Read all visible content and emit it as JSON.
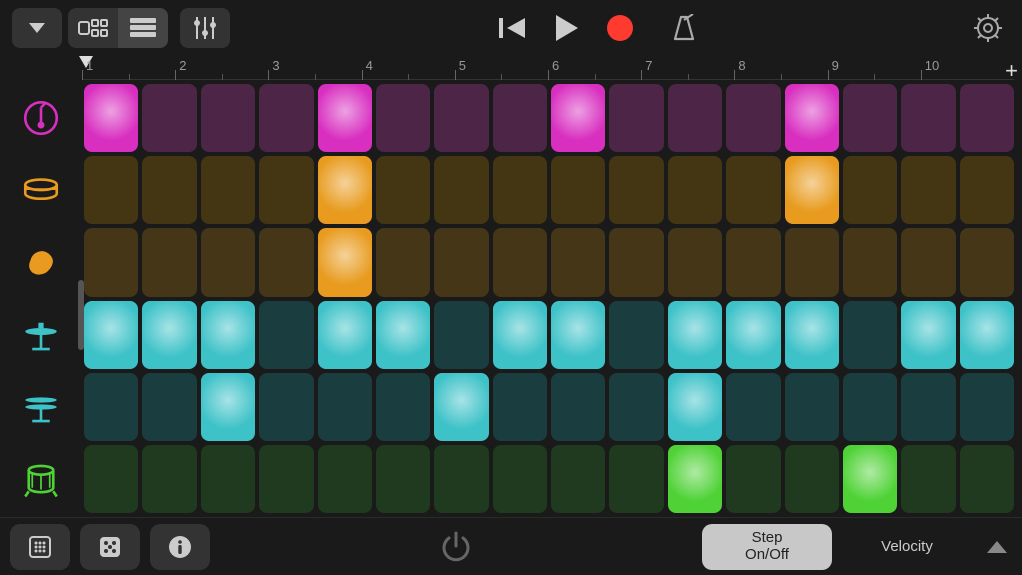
{
  "toolbar": {
    "dropdown": "▼",
    "view_pad": "pad-view",
    "view_list": "list-view",
    "mixer": "mixer",
    "rewind": "⏮",
    "play": "▶",
    "record": "●",
    "metronome": "metronome",
    "settings": "⚙"
  },
  "ruler": {
    "bars": [
      "1",
      "2",
      "3",
      "4",
      "5",
      "6",
      "7",
      "8",
      "9",
      "10"
    ],
    "add": "+"
  },
  "rows": [
    {
      "name": "kick",
      "color": "#d82fc0"
    },
    {
      "name": "snare",
      "color": "#e89b1e"
    },
    {
      "name": "clap",
      "color": "#e89b1e"
    },
    {
      "name": "hihat-closed",
      "color": "#3dc2c8"
    },
    {
      "name": "hihat-open",
      "color": "#3dc2c8"
    },
    {
      "name": "tom",
      "color": "#4fd236"
    }
  ],
  "steps_per_row": 16,
  "pattern": [
    [
      1,
      0,
      0,
      0,
      1,
      0,
      0,
      0,
      1,
      0,
      0,
      0,
      1,
      0,
      0,
      0
    ],
    [
      0,
      0,
      0,
      0,
      1,
      0,
      0,
      0,
      0,
      0,
      0,
      0,
      1,
      0,
      0,
      0
    ],
    [
      0,
      0,
      0,
      0,
      1,
      0,
      0,
      0,
      0,
      0,
      0,
      0,
      0,
      0,
      0,
      0
    ],
    [
      1,
      1,
      1,
      0,
      1,
      1,
      0,
      1,
      1,
      0,
      1,
      1,
      1,
      0,
      1,
      1
    ],
    [
      0,
      0,
      1,
      0,
      0,
      0,
      1,
      0,
      0,
      0,
      1,
      0,
      0,
      0,
      0,
      0
    ],
    [
      0,
      0,
      0,
      0,
      0,
      0,
      0,
      0,
      0,
      0,
      1,
      0,
      0,
      1,
      0,
      0
    ]
  ],
  "bottom": {
    "grid_btn": "grid",
    "dice_btn": "randomize",
    "info_btn": "info",
    "power_btn": "power",
    "mode_on": "Step\nOn/Off",
    "mode_velocity": "Velocity",
    "arrow": "▲"
  }
}
